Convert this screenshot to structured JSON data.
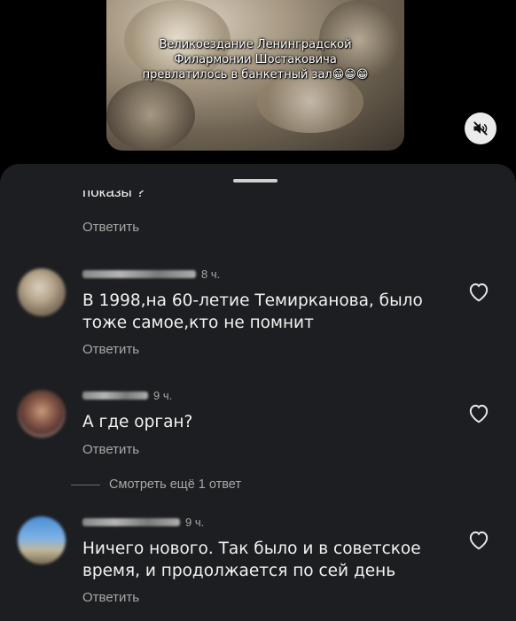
{
  "video": {
    "caption": "Великоездание Ленинградской Филармонии Шостаковича превлатилось в банкетный зал😁😁😁",
    "mute_icon": "speaker-muted-icon"
  },
  "partial_comment": {
    "text_tail": "показы ?",
    "reply_label": "Ответить"
  },
  "comments": [
    {
      "time": "8 ч.",
      "text_line1": "В 1998,на 60-летие Темирканова, было",
      "text_line2": "тоже самое,кто не помнит",
      "reply_label": "Ответить"
    },
    {
      "time": "9 ч.",
      "text_line1": "А где орган?",
      "reply_label": "Ответить",
      "more_replies": "Смотреть ещё 1 ответ"
    },
    {
      "time": "9 ч.",
      "text_line1": "Ничего нового. Так было и в советское",
      "text_line2": "время, и продолжается по сей день",
      "reply_label": "Ответить"
    }
  ],
  "colors": {
    "sheet_bg": "#1d1e21",
    "text_primary": "#f2f2f2",
    "text_secondary": "#a8a8a8"
  }
}
